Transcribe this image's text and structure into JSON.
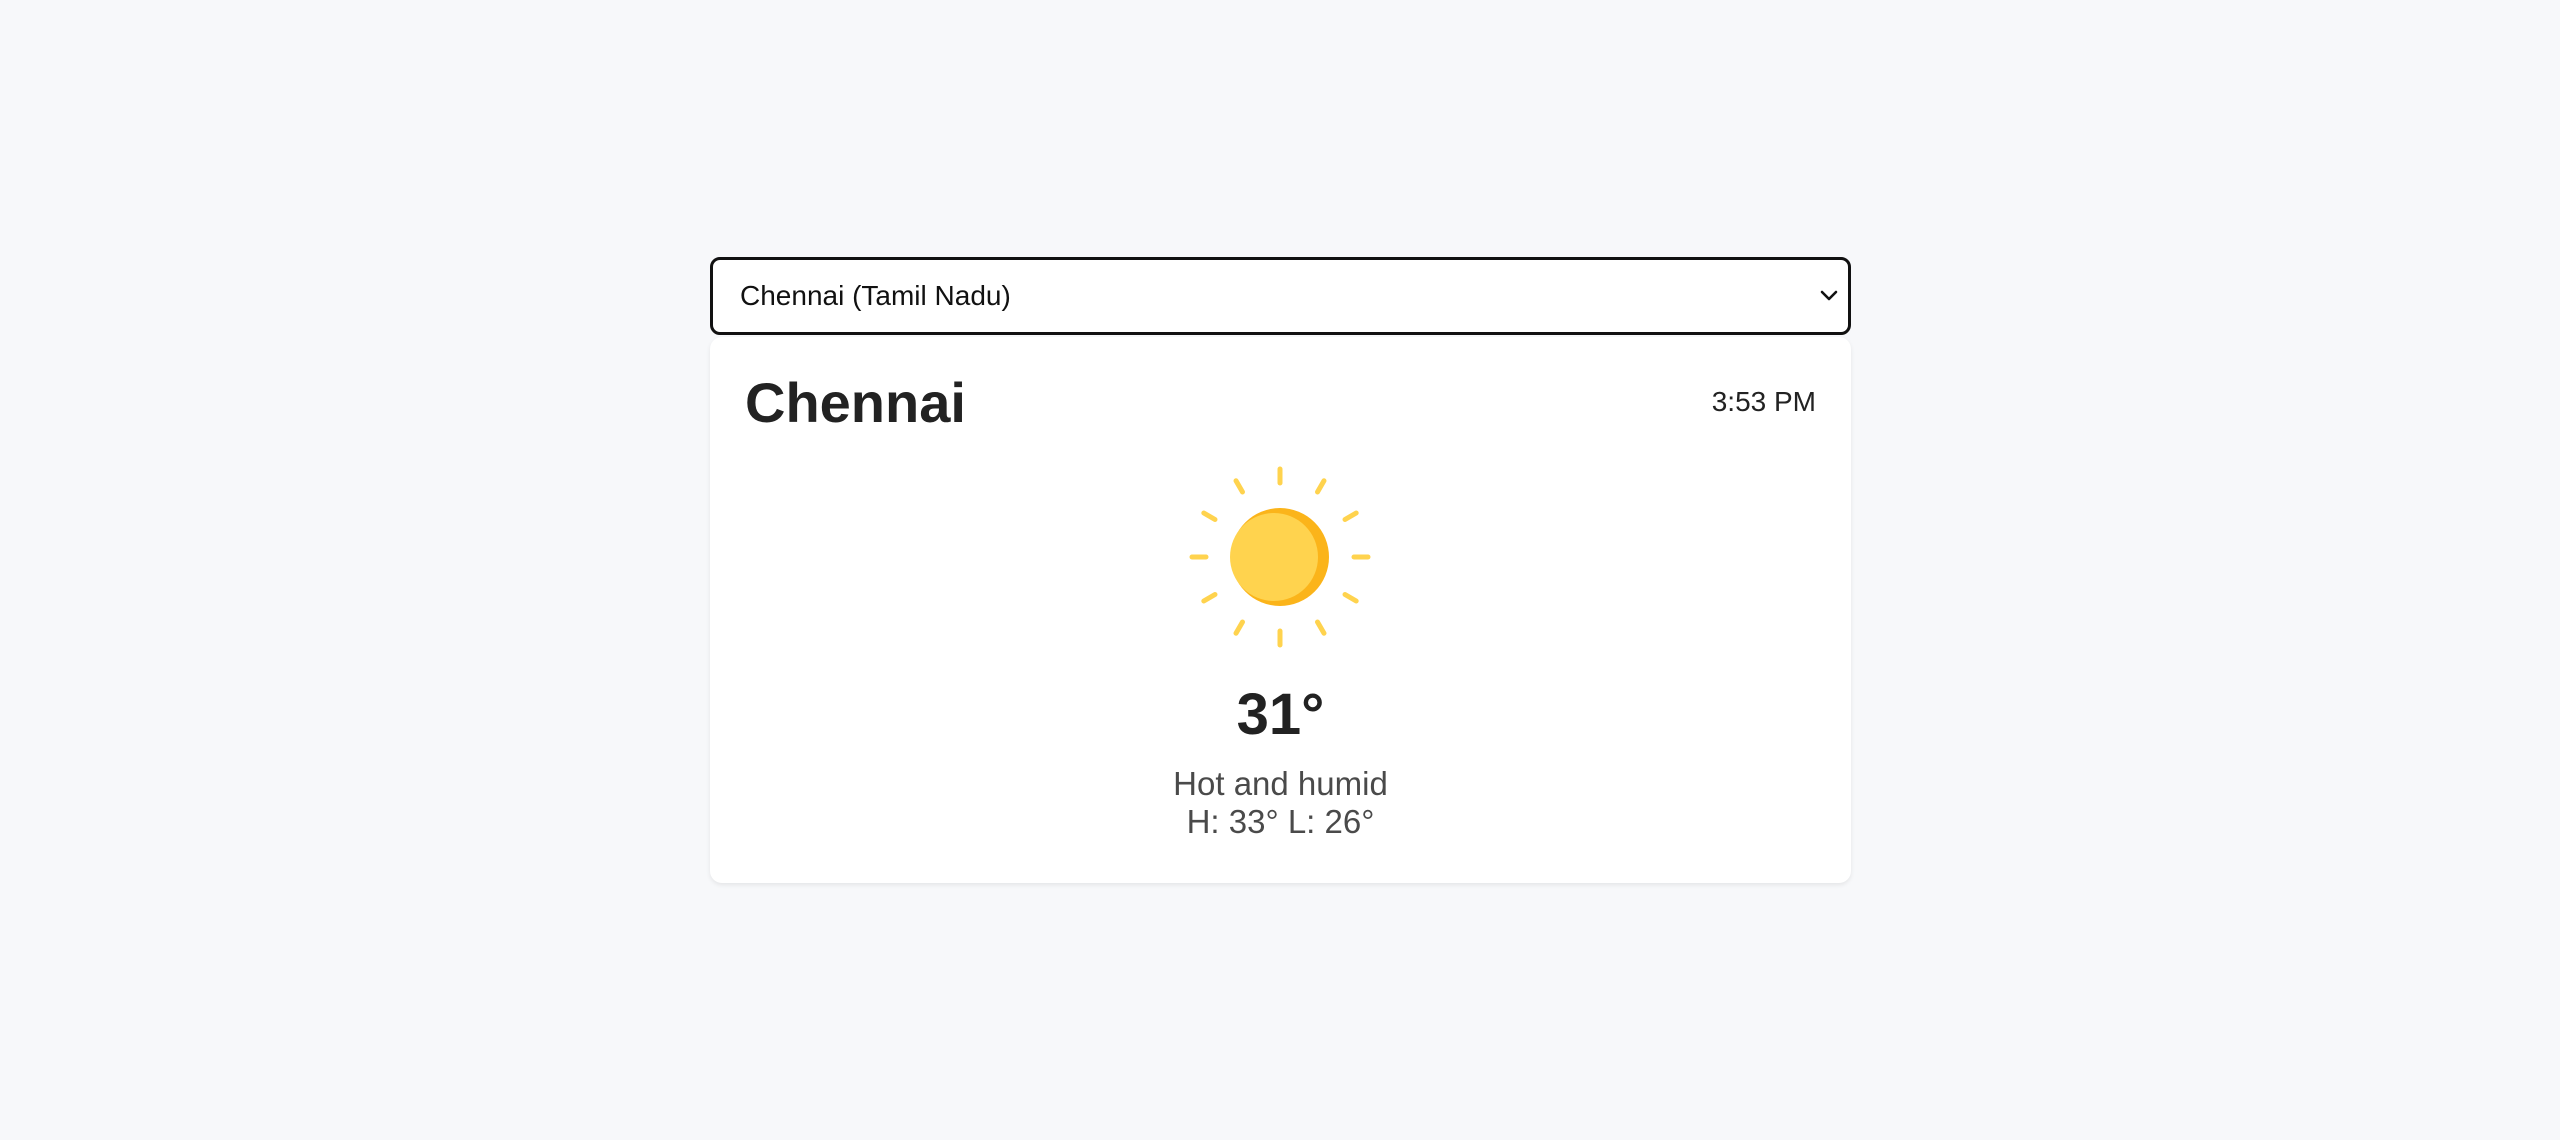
{
  "location_select": {
    "selected": "Chennai (Tamil Nadu)",
    "chevron_icon": "chevron-down-icon"
  },
  "weather": {
    "city": "Chennai",
    "time": "3:53 PM",
    "icon": "sun-icon",
    "temperature": "31°",
    "description": "Hot and humid",
    "high_low": "H: 33° L: 26°"
  },
  "colors": {
    "background": "#f7f8fa",
    "card": "#ffffff",
    "sun": "#ffd34e",
    "sun_shade": "#fbb41a",
    "rays": "#ffd34e"
  }
}
